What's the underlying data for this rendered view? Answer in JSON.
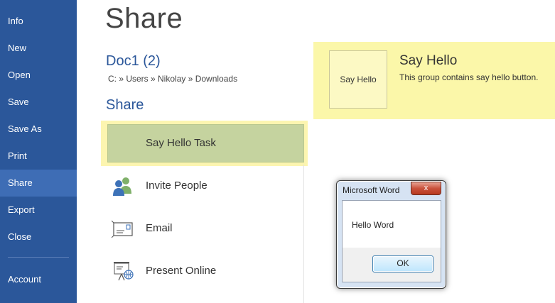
{
  "sidebar": {
    "items": [
      {
        "label": "Info"
      },
      {
        "label": "New"
      },
      {
        "label": "Open"
      },
      {
        "label": "Save"
      },
      {
        "label": "Save As"
      },
      {
        "label": "Print"
      },
      {
        "label": "Share",
        "active": true
      },
      {
        "label": "Export"
      },
      {
        "label": "Close"
      },
      {
        "label": "Account"
      }
    ],
    "bg_color": "#2b579a",
    "active_color": "#3e6db5"
  },
  "main": {
    "page_title": "Share",
    "doc_name": "Doc1 (2)",
    "breadcrumb": "C: » Users » Nikolay » Downloads",
    "section_title": "Share",
    "accent_color": "#2b579a",
    "options": [
      {
        "label": "Say Hello Task",
        "selected": true
      },
      {
        "label": "Invite People",
        "icon": "invite-people-icon"
      },
      {
        "label": "Email",
        "icon": "email-icon"
      },
      {
        "label": "Present Online",
        "icon": "present-online-icon"
      }
    ]
  },
  "group": {
    "button_label": "Say Hello",
    "title": "Say Hello",
    "description": "This group contains say hello button.",
    "highlight_color": "#fbf7a9"
  },
  "dialog": {
    "title": "Microsoft Word",
    "close_glyph": "x",
    "message": "Hello Word",
    "ok_label": "OK"
  }
}
